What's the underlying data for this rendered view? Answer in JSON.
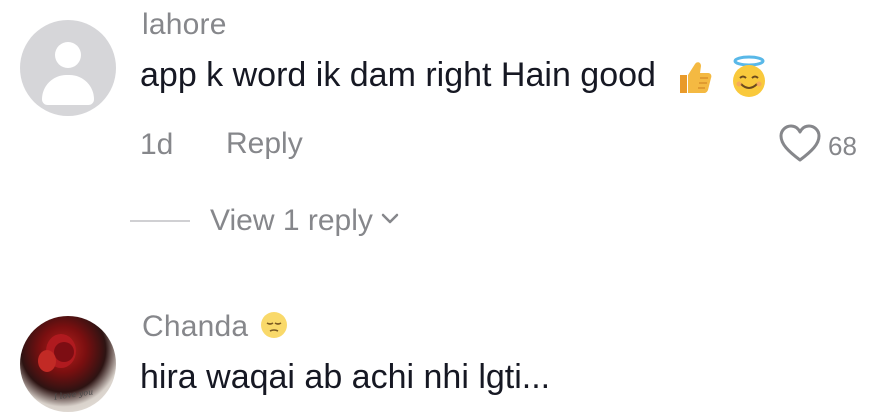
{
  "comments": [
    {
      "username": "lahore",
      "text": "app k word ik dam right Hain good",
      "emojis": [
        "thumbs-up-emoji",
        "smiling-face-with-halo-emoji"
      ],
      "time": "1d",
      "reply_label": "Reply",
      "likes": "68",
      "view_replies_label": "View 1 reply"
    },
    {
      "username": "Chanda",
      "username_emoji": "pensive-face-emoji",
      "text": "hira waqai ab achi nhi lgti...",
      "avatar_caption": "I love you"
    }
  ],
  "colors": {
    "muted_text": "#86878b",
    "primary_text": "#161823",
    "avatar_placeholder": "#d6d6d9"
  }
}
